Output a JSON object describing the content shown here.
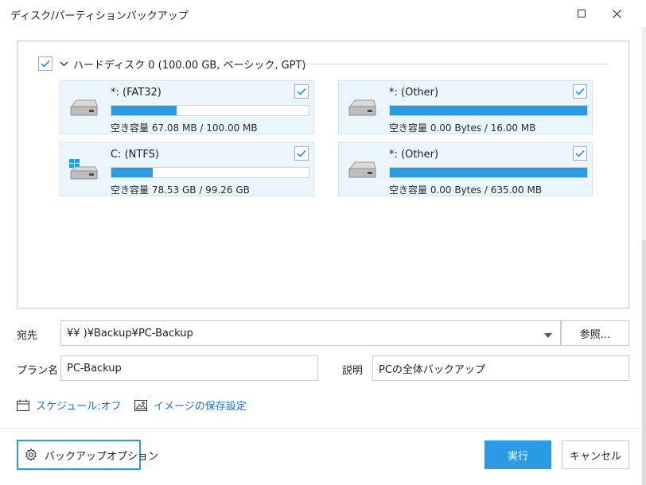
{
  "window": {
    "title": "ディスク/パーティションバックアップ",
    "minimize_icon": "minimize-icon",
    "maximize_icon": "maximize-icon",
    "close_icon": "close-icon"
  },
  "disk": {
    "label": "ハードディスク 0 (100.00 GB, ベーシック, GPT)",
    "checked": true
  },
  "partitions": [
    {
      "name": "*: (FAT32)",
      "free": "空き容量 67.08 MB / 100.00 MB",
      "used_fraction": 0.33,
      "icon": "drive-icon",
      "checked": true
    },
    {
      "name": "*: (Other)",
      "free": "空き容量 0.00 Bytes / 16.00 MB",
      "used_fraction": 1.0,
      "icon": "drive-icon",
      "checked": true
    },
    {
      "name": "C: (NTFS)",
      "free": "空き容量 78.53 GB / 99.26 GB",
      "used_fraction": 0.21,
      "icon": "windows-drive-icon",
      "checked": true
    },
    {
      "name": "*: (Other)",
      "free": "空き容量 0.00 Bytes / 635.00 MB",
      "used_fraction": 1.0,
      "icon": "drive-icon",
      "checked": true
    }
  ],
  "destination": {
    "label": "宛先",
    "value": "¥¥                          )¥Backup¥PC-Backup",
    "browse_label": "参照..."
  },
  "plan": {
    "label": "プラン名",
    "value": "PC-Backup"
  },
  "description": {
    "label": "説明",
    "value": "PCの全体バックアップ"
  },
  "links": {
    "schedule": "スケジュール:オフ",
    "image_settings": "イメージの保存設定"
  },
  "buttons": {
    "options": "バックアップオプション",
    "run": "実行",
    "cancel": "キャンセル"
  },
  "colors": {
    "accent": "#2b9be6",
    "link": "#1a73c9",
    "card_bg": "#eaf5fc"
  }
}
